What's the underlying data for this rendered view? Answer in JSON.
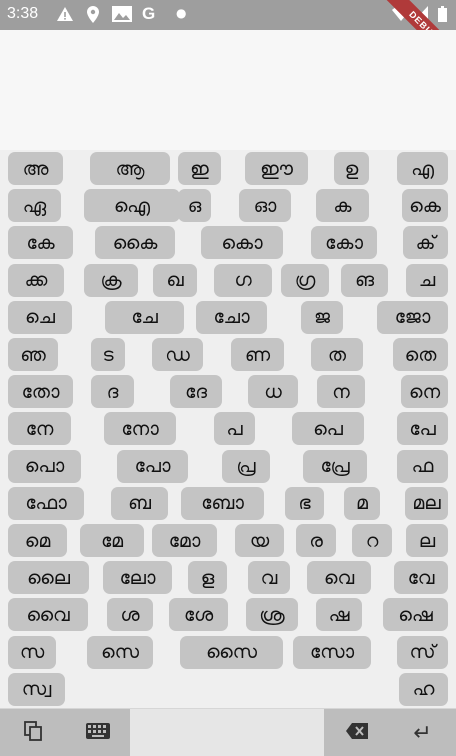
{
  "status_bar": {
    "time": "3:38",
    "icons": [
      "warning-icon",
      "location-icon",
      "gallery-icon",
      "google-icon",
      "dot-icon",
      "wifi-icon",
      "signal-icon",
      "battery-icon"
    ],
    "color": "#9e9e9e"
  },
  "debug_banner": "DEBUG",
  "keyboard": {
    "key_color": "#c4c4c4",
    "rows": [
      [
        "അ",
        "ആ",
        "ഇ",
        "ഈ",
        "ഉ",
        "എ"
      ],
      [
        "ഏ",
        "ഐ",
        "ഒ",
        "ഓ",
        "ക",
        "കെ"
      ],
      [
        "കേ",
        "കൈ",
        "കൊ",
        "കോ",
        "ക്"
      ],
      [
        "ക്ക",
        "ക്ര",
        "ഖ",
        "ഗ",
        "ഗ്ര",
        "ങ",
        "ച"
      ],
      [
        "ചെ",
        "ചേ",
        "ചോ",
        "ജ",
        "ജോ"
      ],
      [
        "ഞ",
        "ട",
        "ഡ",
        "ണ",
        "ത",
        "തെ"
      ],
      [
        "തോ",
        "ദ",
        "ദേ",
        "ധ",
        "ന",
        "നെ"
      ],
      [
        "നേ",
        "നോ",
        "പ",
        "പെ",
        "പേ"
      ],
      [
        "പൊ",
        "പോ",
        "പ്ര",
        "പ്രേ",
        "ഫ"
      ],
      [
        "ഫോ",
        "ബ",
        "ബോ",
        "ഭ",
        "മ",
        "മല"
      ],
      [
        "മെ",
        "മേ",
        "മോ",
        "യ",
        "ര",
        "റ",
        "ല"
      ],
      [
        "ലൈ",
        "ലോ",
        "ള",
        "വ",
        "വെ",
        "വേ"
      ],
      [
        "വൈ",
        "ശ",
        "ശേ",
        "ശ്ര",
        "ഷ",
        "ഷെ"
      ],
      [
        "സ",
        "സെ",
        "സൈ",
        "സോ",
        "സ്"
      ],
      [
        "സ്വ",
        "ഹ"
      ]
    ]
  },
  "toolbar": {
    "buttons": [
      "copy-icon",
      "keyboard-icon",
      "backspace-icon",
      "enter-icon"
    ],
    "enter_glyph": "↵"
  }
}
